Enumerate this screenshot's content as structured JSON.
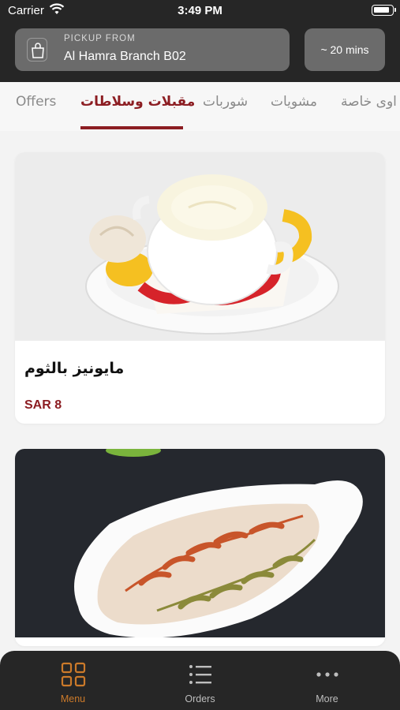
{
  "status_bar": {
    "carrier": "Carrier",
    "time": "3:49 PM"
  },
  "header": {
    "pickup_label": "PICKUP FROM",
    "branch": "Al Hamra Branch B02",
    "eta": "~ 20 mins"
  },
  "tabs": [
    {
      "label": "Offers",
      "active": false
    },
    {
      "label": "مقبلات وسلاطات",
      "active": true
    },
    {
      "label": "شوربات",
      "active": false
    },
    {
      "label": "مشويات",
      "active": false
    },
    {
      "label": "اوى خاصة",
      "active": false
    }
  ],
  "menu_items": [
    {
      "name": "مايونيز بالثوم",
      "price": "SAR 8"
    },
    {
      "name": "",
      "price": ""
    }
  ],
  "bottom_nav": [
    {
      "label": "Menu",
      "icon": "grid-icon",
      "active": true
    },
    {
      "label": "Orders",
      "icon": "list-icon",
      "active": false
    },
    {
      "label": "More",
      "icon": "more-icon",
      "active": false
    }
  ],
  "colors": {
    "accent": "#8c1d22",
    "nav_active": "#cc7a2a",
    "header_bg": "#262626"
  }
}
